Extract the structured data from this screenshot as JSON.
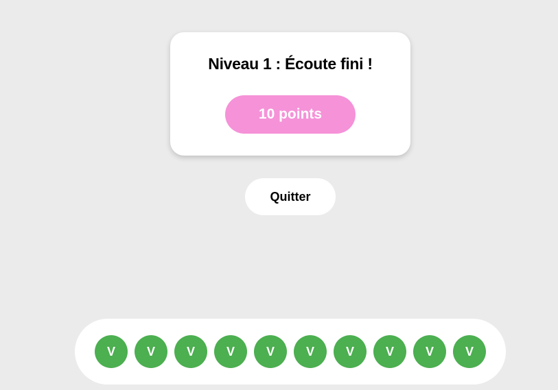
{
  "result": {
    "title": "Niveau 1 : Écoute fini !",
    "points": "10 points"
  },
  "actions": {
    "quit_label": "Quitter"
  },
  "progress": {
    "marks": [
      {
        "label": "V",
        "status": "correct"
      },
      {
        "label": "V",
        "status": "correct"
      },
      {
        "label": "V",
        "status": "correct"
      },
      {
        "label": "V",
        "status": "correct"
      },
      {
        "label": "V",
        "status": "correct"
      },
      {
        "label": "V",
        "status": "correct"
      },
      {
        "label": "V",
        "status": "correct"
      },
      {
        "label": "V",
        "status": "correct"
      },
      {
        "label": "V",
        "status": "correct"
      },
      {
        "label": "V",
        "status": "correct"
      }
    ]
  },
  "colors": {
    "background": "#ebebeb",
    "points_badge": "#f592d8",
    "correct": "#4caf50"
  }
}
